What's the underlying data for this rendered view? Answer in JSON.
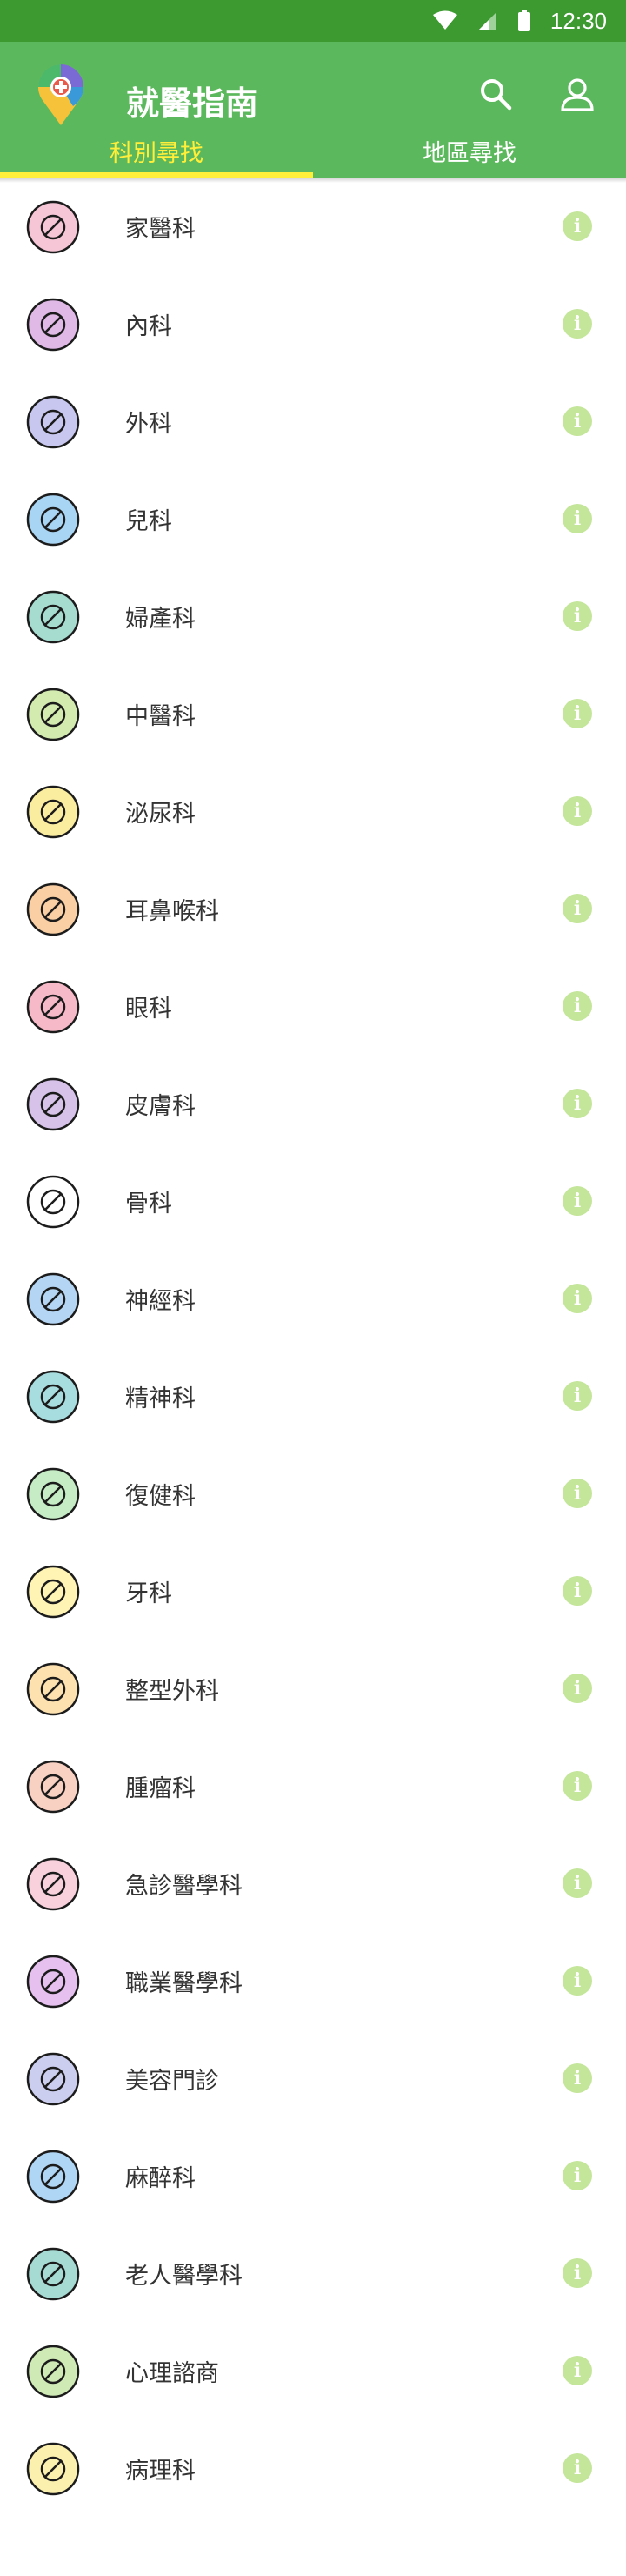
{
  "status_bar": {
    "time": "12:30",
    "icons": [
      "wifi-icon",
      "signal-icon",
      "battery-icon"
    ]
  },
  "app_bar": {
    "title": "就醫指南",
    "actions": [
      "search-icon",
      "account-icon"
    ],
    "color": "#5cb85c"
  },
  "tabs": [
    {
      "label": "科別尋找",
      "active": true
    },
    {
      "label": "地區尋找",
      "active": false
    }
  ],
  "accent_color": "#ffee3a",
  "info_icon_color": "#c4e69a",
  "departments": [
    {
      "label": "家醫科",
      "icon": "house-icon",
      "bg": "#f6c6d6"
    },
    {
      "label": "內科",
      "icon": "stethoscope-icon",
      "bg": "#e0b9e6"
    },
    {
      "label": "外科",
      "icon": "surgical-tools-icon",
      "bg": "#c8c7ef"
    },
    {
      "label": "兒科",
      "icon": "baby-bottle-icon",
      "bg": "#a9d5f4"
    },
    {
      "label": "婦產科",
      "icon": "uterus-icon",
      "bg": "#a6dcd0"
    },
    {
      "label": "中醫科",
      "icon": "mortar-icon",
      "bg": "#d4ebb0"
    },
    {
      "label": "泌尿科",
      "icon": "kidney-icon",
      "bg": "#fbeda0"
    },
    {
      "label": "耳鼻喉科",
      "icon": "head-profile-icon",
      "bg": "#f9cfa3"
    },
    {
      "label": "眼科",
      "icon": "eye-icon",
      "bg": "#f6b9c8"
    },
    {
      "label": "皮膚科",
      "icon": "skin-icon",
      "bg": "#d7c2ea"
    },
    {
      "label": "骨科",
      "icon": "bone-joint-icon",
      "bg": "#ffffff"
    },
    {
      "label": "神經科",
      "icon": "neuron-icon",
      "bg": "#b4d6f4"
    },
    {
      "label": "精神科",
      "icon": "mind-icon",
      "bg": "#a8dde0"
    },
    {
      "label": "復健科",
      "icon": "syringe-pen-icon",
      "bg": "#c6ecc5"
    },
    {
      "label": "牙科",
      "icon": "tooth-icon",
      "bg": "#fff4b4"
    },
    {
      "label": "整型外科",
      "icon": "face-surgery-icon",
      "bg": "#fde2b0"
    },
    {
      "label": "腫瘤科",
      "icon": "tumor-icon",
      "bg": "#f9d1c2"
    },
    {
      "label": "急診醫學科",
      "icon": "siren-icon",
      "bg": "#f9d1dd"
    },
    {
      "label": "職業醫學科",
      "icon": "helmet-icon",
      "bg": "#e6c1ef"
    },
    {
      "label": "美容門診",
      "icon": "face-mask-icon",
      "bg": "#cccef0"
    },
    {
      "label": "麻醉科",
      "icon": "injection-icon",
      "bg": "#b0d6f6"
    },
    {
      "label": "老人醫學科",
      "icon": "elderly-icon",
      "bg": "#a6dbd4"
    },
    {
      "label": "心理諮商",
      "icon": "counseling-icon",
      "bg": "#cfeab5"
    },
    {
      "label": "病理科",
      "icon": "microscope-icon",
      "bg": "#fbf0ad"
    }
  ]
}
